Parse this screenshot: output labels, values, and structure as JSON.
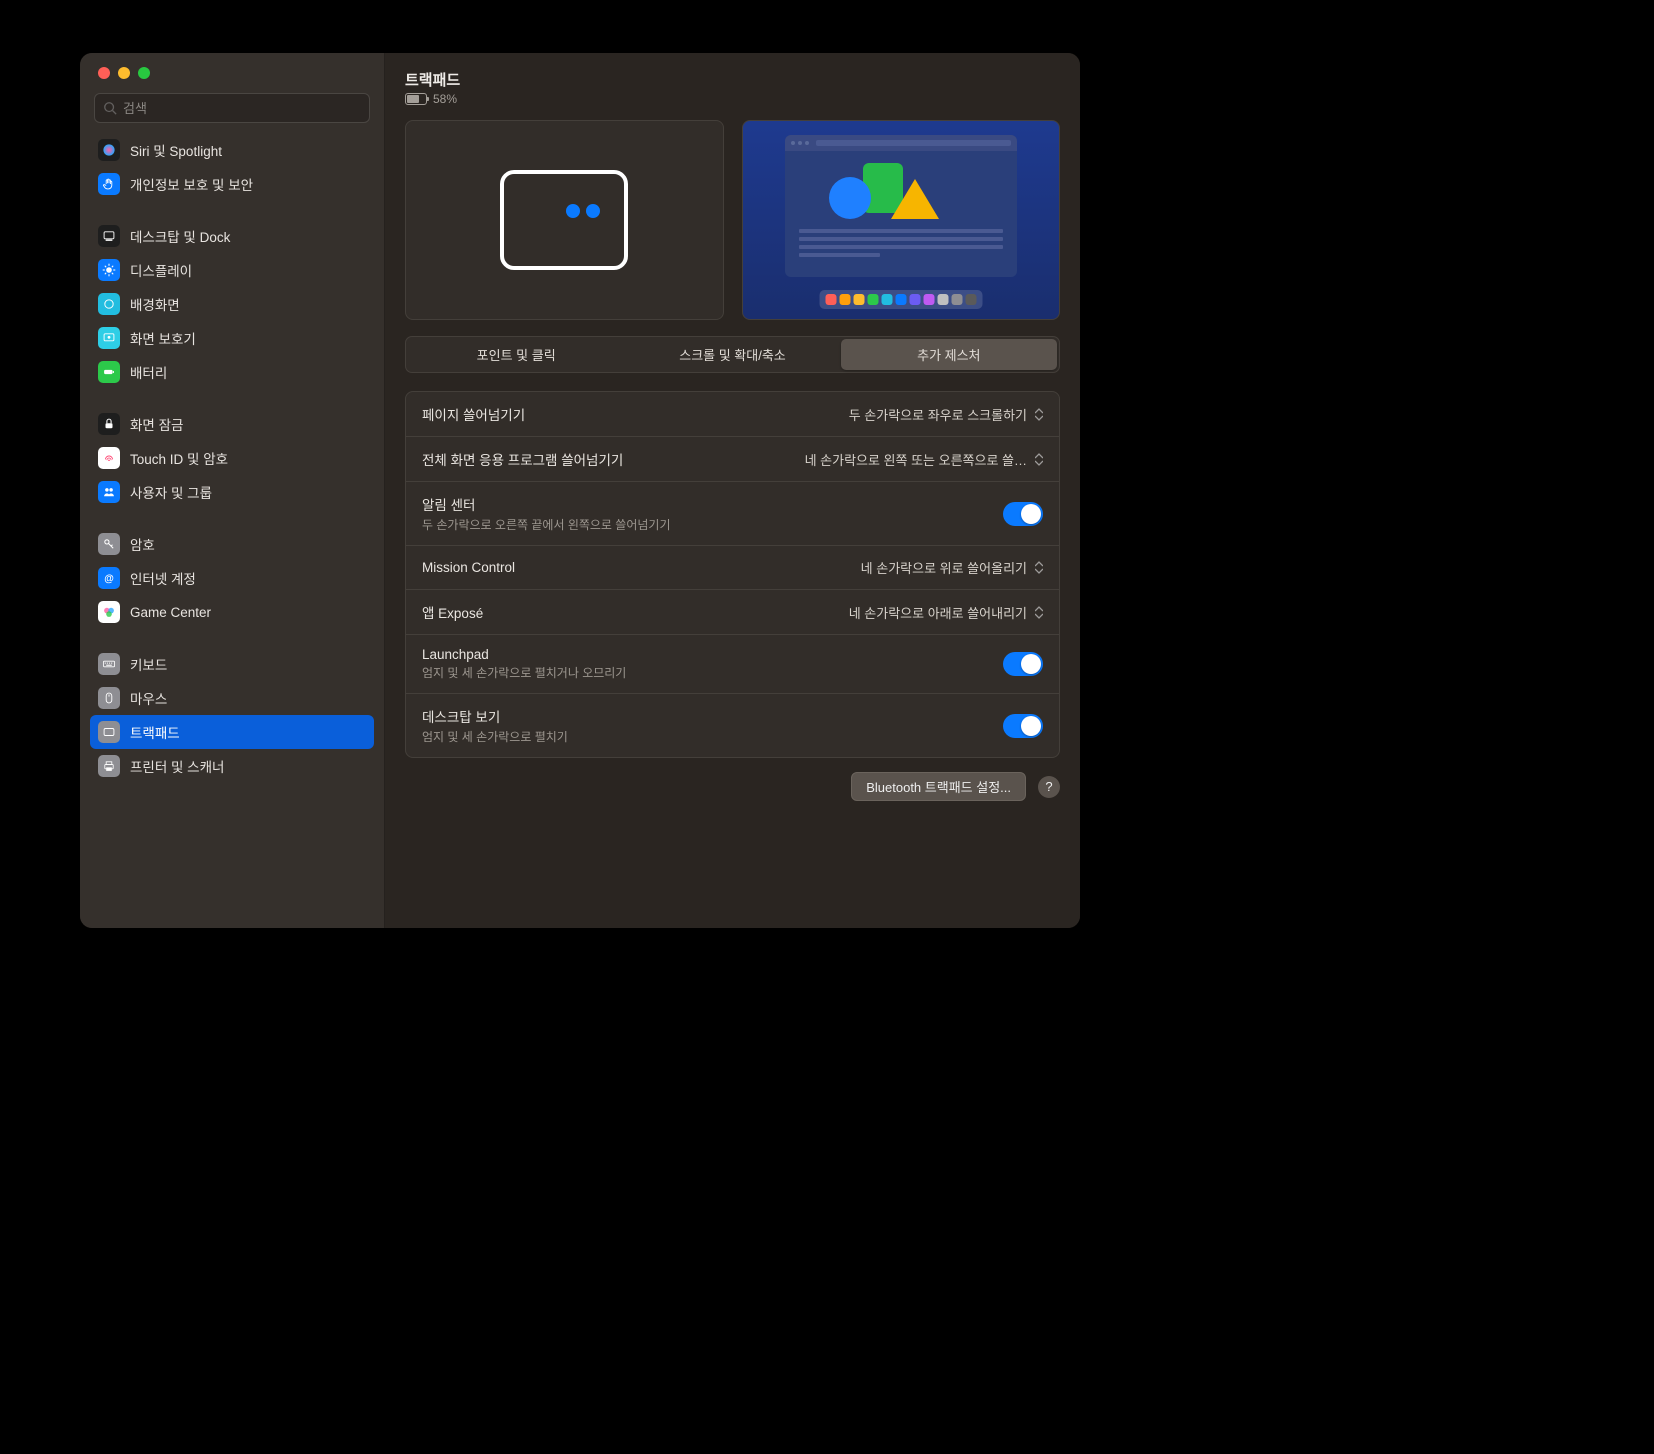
{
  "header": {
    "title": "트랙패드",
    "battery_percent": "58%"
  },
  "search": {
    "placeholder": "검색"
  },
  "sidebar": {
    "items": [
      {
        "label": "Siri 및 Spotlight",
        "icon": "siri-icon",
        "bg": "#1e1e1e"
      },
      {
        "label": "개인정보 보호 및 보안",
        "icon": "hand-icon",
        "bg": "#0a7aff"
      },
      {
        "gap": true
      },
      {
        "label": "데스크탑 및 Dock",
        "icon": "dock-icon",
        "bg": "#1e1e1e"
      },
      {
        "label": "디스플레이",
        "icon": "display-icon",
        "bg": "#0a7aff"
      },
      {
        "label": "배경화면",
        "icon": "wallpaper-icon",
        "bg": "#22bde0"
      },
      {
        "label": "화면 보호기",
        "icon": "screensaver-icon",
        "bg": "#2ecee6"
      },
      {
        "label": "배터리",
        "icon": "battery-icon",
        "bg": "#2cc94a"
      },
      {
        "gap": true
      },
      {
        "label": "화면 잠금",
        "icon": "lock-icon",
        "bg": "#1e1e1e"
      },
      {
        "label": "Touch ID 및 암호",
        "icon": "touchid-icon",
        "bg": "#ffffff"
      },
      {
        "label": "사용자 및 그룹",
        "icon": "users-icon",
        "bg": "#0a7aff"
      },
      {
        "gap": true
      },
      {
        "label": "암호",
        "icon": "key-icon",
        "bg": "#8e8e93"
      },
      {
        "label": "인터넷 계정",
        "icon": "at-icon",
        "bg": "#0a7aff"
      },
      {
        "label": "Game Center",
        "icon": "gamecenter-icon",
        "bg": "#ffffff"
      },
      {
        "gap": true
      },
      {
        "label": "키보드",
        "icon": "keyboard-icon",
        "bg": "#8e8e93"
      },
      {
        "label": "마우스",
        "icon": "mouse-icon",
        "bg": "#8e8e93"
      },
      {
        "label": "트랙패드",
        "icon": "trackpad-icon",
        "bg": "#8e8e93",
        "selected": true
      },
      {
        "label": "프린터 및 스캐너",
        "icon": "printer-icon",
        "bg": "#8e8e93"
      }
    ]
  },
  "tabs": [
    {
      "label": "포인트 및 클릭"
    },
    {
      "label": "스크롤 및 확대/축소"
    },
    {
      "label": "추가 제스처",
      "active": true
    }
  ],
  "rows": {
    "page_swipe": {
      "title": "페이지 쓸어넘기기",
      "value": "두 손가락으로 좌우로 스크롤하기"
    },
    "fullscreen_swipe": {
      "title": "전체 화면 응용 프로그램 쓸어넘기기",
      "value": "네 손가락으로 왼쪽 또는 오른쪽으로 쓸…"
    },
    "notification": {
      "title": "알림 센터",
      "sub": "두 손가락으로 오른쪽 끝에서 왼쪽으로 쓸어넘기기"
    },
    "mission": {
      "title": "Mission Control",
      "value": "네 손가락으로 위로 쓸어올리기"
    },
    "expose": {
      "title": "앱 Exposé",
      "value": "네 손가락으로 아래로 쓸어내리기"
    },
    "launchpad": {
      "title": "Launchpad",
      "sub": "엄지 및 세 손가락으로 펼치거나 오므리기"
    },
    "desktop": {
      "title": "데스크탑 보기",
      "sub": "엄지 및 세 손가락으로 펼치기"
    }
  },
  "footer": {
    "bluetooth_btn": "Bluetooth 트랙패드 설정...",
    "help": "?"
  },
  "dock_colors": [
    "#ff5f57",
    "#ff9f0a",
    "#febc2e",
    "#2cc94a",
    "#22bde0",
    "#0a7aff",
    "#6b5cf2",
    "#bf5af2",
    "#c0c0c0",
    "#8e8e93",
    "#5a5a5a"
  ]
}
